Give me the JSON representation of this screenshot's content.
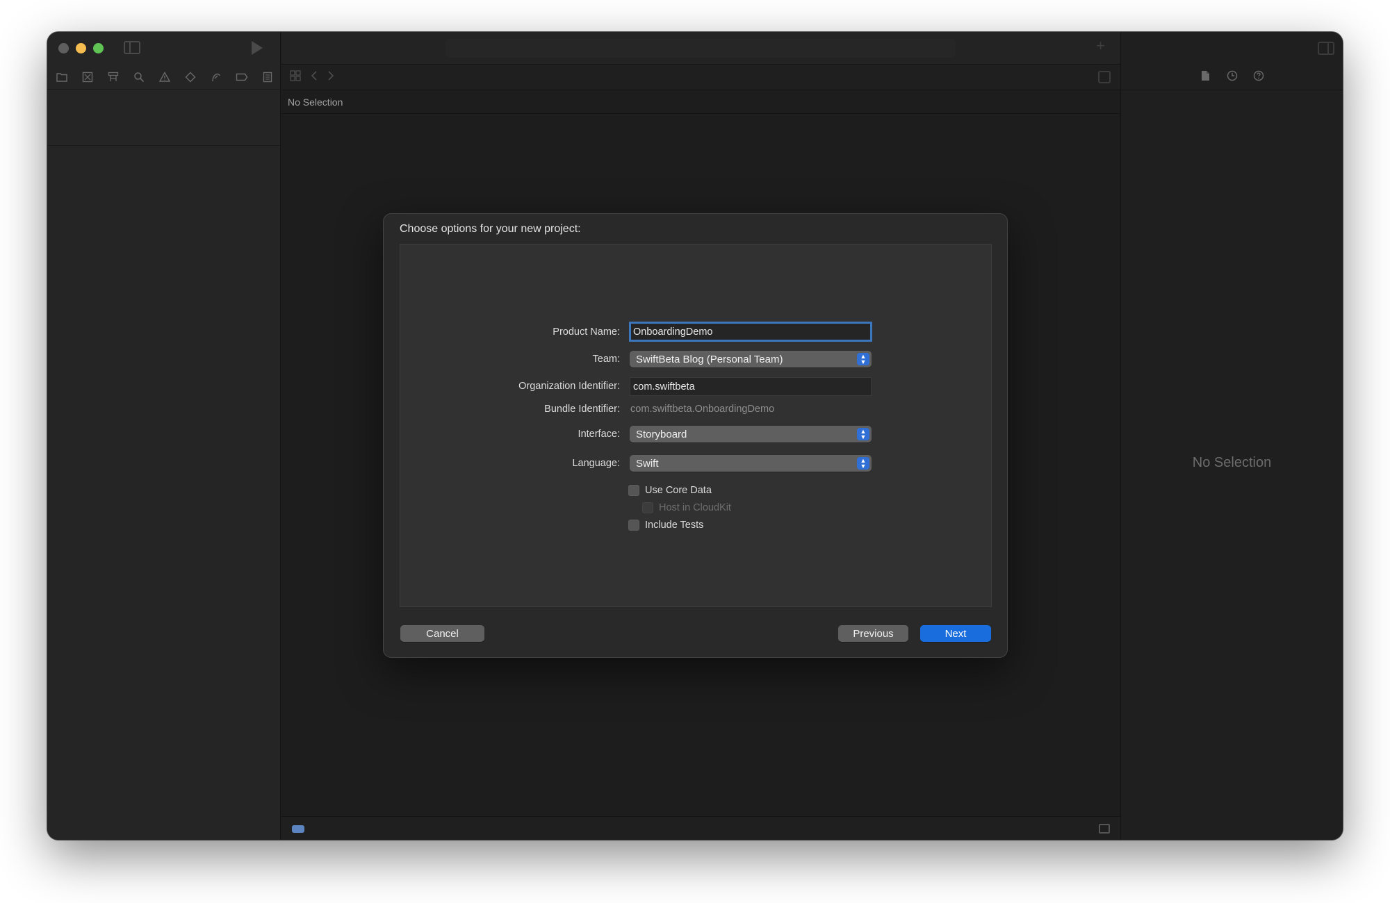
{
  "navigator": {
    "tab_icons": [
      "folder-icon",
      "source-control-icon",
      "symbol-icon",
      "search-icon",
      "warning-icon",
      "test-icon",
      "debug-icon",
      "breakpoint-icon",
      "report-icon"
    ]
  },
  "editor": {
    "path_text": "No Selection"
  },
  "inspector": {
    "empty_text": "No Selection",
    "tab_icons": [
      "file-icon",
      "history-icon",
      "help-icon"
    ]
  },
  "sheet": {
    "title": "Choose options for your new project:",
    "fields": {
      "product_name": {
        "label": "Product Name:",
        "value": "OnboardingDemo"
      },
      "team": {
        "label": "Team:",
        "value": "SwiftBeta Blog (Personal Team)"
      },
      "org_identifier": {
        "label": "Organization Identifier:",
        "value": "com.swiftbeta"
      },
      "bundle_identifier": {
        "label": "Bundle Identifier:",
        "value": "com.swiftbeta.OnboardingDemo"
      },
      "interface": {
        "label": "Interface:",
        "value": "Storyboard"
      },
      "language": {
        "label": "Language:",
        "value": "Swift"
      }
    },
    "checkboxes": {
      "use_core_data": {
        "label": "Use Core Data",
        "checked": false
      },
      "host_in_cloudkit": {
        "label": "Host in CloudKit",
        "checked": false,
        "disabled": true
      },
      "include_tests": {
        "label": "Include Tests",
        "checked": false
      }
    },
    "buttons": {
      "cancel": "Cancel",
      "previous": "Previous",
      "next": "Next"
    },
    "accent_color": "#1a6ddc"
  }
}
